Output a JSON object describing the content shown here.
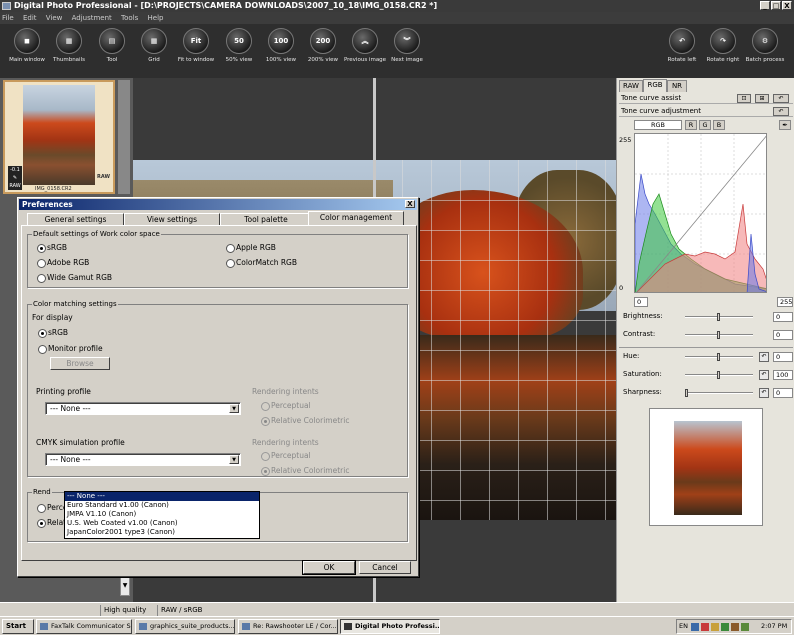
{
  "window": {
    "title": "Digital Photo Professional - [D:\\PROJECTS\\CAMERA DOWNLOADS\\2007_10_18\\IMG_0158.CR2 *]",
    "controls": [
      "_",
      "□",
      "X"
    ]
  },
  "menu": [
    "File",
    "Edit",
    "View",
    "Adjustment",
    "Tools",
    "Help"
  ],
  "toolbar": {
    "left": [
      {
        "label": "Main window",
        "glyph": "◼"
      },
      {
        "label": "Thumbnails",
        "glyph": "▦"
      },
      {
        "label": "Tool",
        "glyph": "▤"
      },
      {
        "label": "Grid",
        "glyph": "▦"
      },
      {
        "label": "Fit to window",
        "glyph": "Fit"
      },
      {
        "label": "50% view",
        "glyph": "50"
      },
      {
        "label": "100% view",
        "glyph": "100"
      },
      {
        "label": "200% view",
        "glyph": "200"
      },
      {
        "label": "Previous image",
        "glyph": "︽"
      },
      {
        "label": "Next image",
        "glyph": "︾"
      }
    ],
    "right": [
      {
        "label": "Rotate left",
        "glyph": "↶"
      },
      {
        "label": "Rotate right",
        "glyph": "↷"
      },
      {
        "label": "Batch process",
        "glyph": "⚙"
      }
    ]
  },
  "thumbnail": {
    "filename": "IMG_0158.CR2",
    "badge_top": "-0.1",
    "badge_raw": "RAW",
    "raw_label": "RAW"
  },
  "statusbar": {
    "quality": "High quality",
    "colorspace": "RAW / sRGB"
  },
  "taskbar": {
    "start": "Start",
    "items": [
      "FaxTalk Communicator SE",
      "graphics_suite_products...",
      "Re: Rawshooter LE / Cor...",
      "Digital Photo Professi..."
    ],
    "tray_lang": "EN",
    "clock": "2:07 PM"
  },
  "right_panel": {
    "tabs": [
      "RAW",
      "RGB",
      "NR"
    ],
    "active_tab": "RGB",
    "tone_curve_assist": "Tone curve assist",
    "tone_curve_adjustment": "Tone curve adjustment",
    "channels": [
      "RGB",
      "R",
      "G",
      "B"
    ],
    "histogram_top": "255",
    "histogram_bottom": "0",
    "input_low": "0",
    "input_high": "255",
    "brightness": {
      "label": "Brightness:",
      "value": "0",
      "level": 0.5
    },
    "contrast": {
      "label": "Contrast:",
      "value": "0",
      "level": 0.5
    },
    "hue": {
      "label": "Hue:",
      "value": "0",
      "level": 0.5
    },
    "saturation": {
      "label": "Saturation:",
      "value": "100",
      "level": 0.5
    },
    "sharpness": {
      "label": "Sharpness:",
      "value": "0",
      "level": 0.0
    }
  },
  "dialog": {
    "title": "Preferences",
    "close": "X",
    "tabs": [
      "General settings",
      "View settings",
      "Tool palette",
      "Color management"
    ],
    "active_tab": "Color management",
    "work_space": {
      "label": "Default settings of Work color space",
      "options": [
        "sRGB",
        "Adobe RGB",
        "Wide Gamut RGB",
        "Apple RGB",
        "ColorMatch RGB"
      ],
      "selected": "sRGB"
    },
    "color_matching": {
      "label": "Color matching settings",
      "for_display": "For display",
      "display_options": [
        "sRGB",
        "Monitor profile"
      ],
      "display_selected": "sRGB",
      "browse": "Browse",
      "printing_profile_label": "Printing profile",
      "printing_profile_value": "--- None ---",
      "cmyk_label": "CMYK simulation profile",
      "cmyk_value": "--- None ---",
      "rendering_label_1": "Rendering intents",
      "rendering_label_2": "Rendering intents",
      "perceptual": "Perceptual",
      "relative": "Relative Colorimetric"
    },
    "cmyk_dropdown": [
      "--- None ---",
      "Euro Standard v1.00 (Canon)",
      "JMPA V1.10 (Canon)",
      "U.S. Web Coated v1.00 (Canon)",
      "JapanColor2001 type3 (Canon)"
    ],
    "render_group_label": "Rend",
    "render_options": [
      "Perceptual",
      "Relative Colorimetric"
    ],
    "render_selected": "Relative Colorimetric",
    "ok": "OK",
    "cancel": "Cancel"
  }
}
